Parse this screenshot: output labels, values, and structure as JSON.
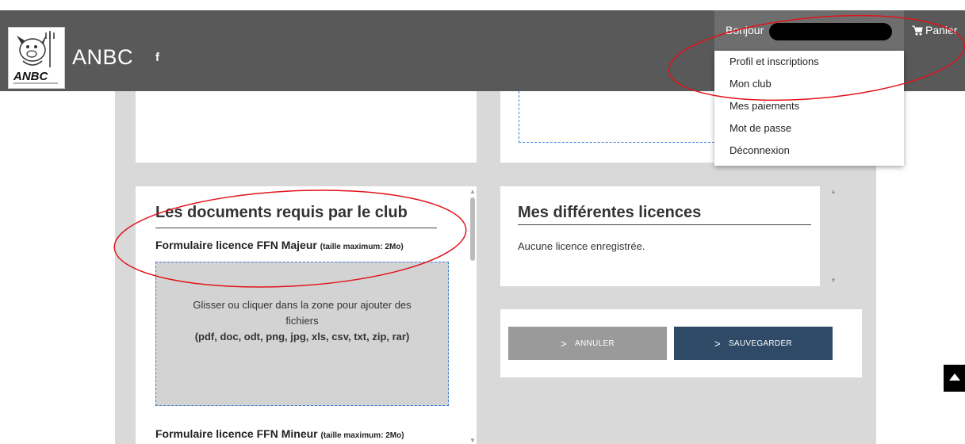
{
  "header": {
    "brand": "ANBC",
    "social_icon": "facebook-icon",
    "facebook_glyph": "f",
    "logo_text": "ANBC",
    "greeting": "Bonjour",
    "cart_label": "Panier",
    "cart_icon": "cart-icon",
    "bg_color": "#595959"
  },
  "user_menu": {
    "items": [
      "Profil et inscriptions",
      "Mon club",
      "Mes paiements",
      "Mot de passe",
      "Déconnexion"
    ]
  },
  "documents": {
    "title": "Les documents requis par le club",
    "field1_label": "Formulaire licence FFN Majeur",
    "field1_hint": "(taille maximum: 2Mo)",
    "dropzone_line1": "Glisser ou cliquer dans la zone pour ajouter des",
    "dropzone_line2": "fichiers",
    "dropzone_ext": "(pdf, doc, odt, png, jpg, xls, csv, txt, zip, rar)",
    "field2_label": "Formulaire licence FFN Mineur",
    "field2_hint": "(taille maximum: 2Mo)"
  },
  "licences": {
    "title": "Mes différentes licences",
    "empty_text": "Aucune licence enregistrée."
  },
  "actions": {
    "cancel_label": "ANNULER",
    "save_label": "SAUVEGARDER",
    "chevron": ">",
    "save_color": "#2f4a66",
    "cancel_color": "#9a9a9a"
  },
  "annotation_color": "#e0141b"
}
